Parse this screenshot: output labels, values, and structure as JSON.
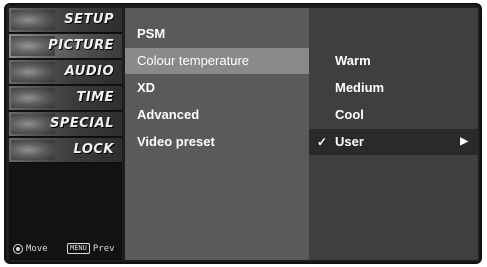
{
  "categories": [
    {
      "label": "SETUP",
      "icon": "setup-thumbnail-icon"
    },
    {
      "label": "PICTURE",
      "icon": "picture-thumbnail-icon"
    },
    {
      "label": "AUDIO",
      "icon": "audio-thumbnail-icon"
    },
    {
      "label": "TIME",
      "icon": "time-thumbnail-icon"
    },
    {
      "label": "SPECIAL",
      "icon": "special-thumbnail-icon"
    },
    {
      "label": "LOCK",
      "icon": "lock-thumbnail-icon"
    }
  ],
  "active_category": "PICTURE",
  "hints": {
    "move_label": "Move",
    "menu_key": "MENU",
    "prev_label": "Prev"
  },
  "menu": {
    "items": [
      {
        "label": "PSM"
      },
      {
        "label": "Colour temperature"
      },
      {
        "label": "XD"
      },
      {
        "label": "Advanced"
      },
      {
        "label": "Video preset"
      }
    ],
    "selected": "Colour temperature"
  },
  "submenu": {
    "items": [
      {
        "label": "Warm"
      },
      {
        "label": "Medium"
      },
      {
        "label": "Cool"
      },
      {
        "label": "User",
        "checked": true,
        "has_arrow": true
      }
    ],
    "check_glyph": "✓",
    "arrow_glyph": "▶"
  }
}
